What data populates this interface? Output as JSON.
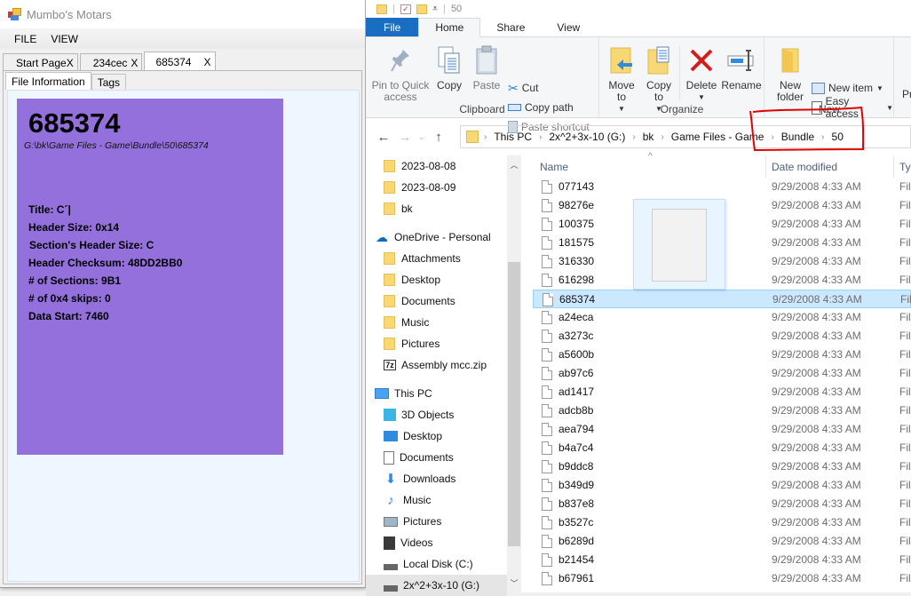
{
  "app": {
    "title": "Mumbo's Motars",
    "menu": [
      "FILE",
      "VIEW"
    ],
    "doc_tabs": [
      {
        "label": "Start Page",
        "close": "X",
        "active": false
      },
      {
        "label": "234cec",
        "close": "X",
        "active": false
      },
      {
        "label": "685374",
        "close": "X",
        "active": true
      }
    ],
    "sub_tabs": [
      {
        "label": "File Information",
        "active": true
      },
      {
        "label": "Tags",
        "active": false
      }
    ],
    "file_info": {
      "id": "685374",
      "path": "G:\\bk\\Game Files - Game\\Bundle\\50\\685374",
      "fields": [
        "Title: C´|",
        "Header Size: 0x14",
        "Section's Header Size: C",
        "Header Checksum: 48DD2BB0",
        "# of Sections: 9B1",
        "# of 0x4 skips: 0",
        "Data Start: 7460"
      ],
      "card_color": "#9370db"
    }
  },
  "explorer": {
    "quick_access_title": "50",
    "ribbon_tabs": [
      "File",
      "Home",
      "Share",
      "View"
    ],
    "active_ribbon_tab": "Home",
    "clipboard": {
      "label": "Clipboard",
      "pin": "Pin to Quick access",
      "copy": "Copy",
      "paste": "Paste",
      "cut": "Cut",
      "copy_path": "Copy path",
      "paste_shortcut": "Paste shortcut"
    },
    "organize": {
      "label": "Organize",
      "move_to": "Move to",
      "copy_to": "Copy to",
      "delete": "Delete",
      "rename": "Rename"
    },
    "new": {
      "label": "New",
      "new_folder": "New folder",
      "new_item": "New item",
      "easy_access": "Easy access"
    },
    "open_partial": "Pr",
    "breadcrumb": [
      "This PC",
      "2x^2+3x-10 (G:)",
      "bk",
      "Game Files - Game",
      "Bundle",
      "50"
    ],
    "nav_pane": [
      {
        "label": "2023-08-08",
        "icon": "folder"
      },
      {
        "label": "2023-08-09",
        "icon": "folder"
      },
      {
        "label": "bk",
        "icon": "folder"
      },
      {
        "label": "OneDrive - Personal",
        "icon": "onedrive"
      },
      {
        "label": "Attachments",
        "icon": "folder"
      },
      {
        "label": "Desktop",
        "icon": "folder"
      },
      {
        "label": "Documents",
        "icon": "folder"
      },
      {
        "label": "Music",
        "icon": "folder"
      },
      {
        "label": "Pictures",
        "icon": "folder"
      },
      {
        "label": "Assembly mcc.zip",
        "icon": "zip"
      },
      {
        "label": "This PC",
        "icon": "pc"
      },
      {
        "label": "3D Objects",
        "icon": "3d"
      },
      {
        "label": "Desktop",
        "icon": "desktop"
      },
      {
        "label": "Documents",
        "icon": "documents"
      },
      {
        "label": "Downloads",
        "icon": "downloads"
      },
      {
        "label": "Music",
        "icon": "music"
      },
      {
        "label": "Pictures",
        "icon": "pictures"
      },
      {
        "label": "Videos",
        "icon": "videos"
      },
      {
        "label": "Local Disk (C:)",
        "icon": "disk"
      },
      {
        "label": "2x^2+3x-10 (G:)",
        "icon": "disk",
        "selected": true
      }
    ],
    "columns": {
      "name": "Name",
      "date": "Date modified",
      "type": "Typ"
    },
    "files": [
      {
        "name": "077143",
        "date": "9/29/2008 4:33 AM",
        "type": "Fil"
      },
      {
        "name": "98276e",
        "date": "9/29/2008 4:33 AM",
        "type": "Fil"
      },
      {
        "name": "100375",
        "date": "9/29/2008 4:33 AM",
        "type": "Fil"
      },
      {
        "name": "181575",
        "date": "9/29/2008 4:33 AM",
        "type": "Fil"
      },
      {
        "name": "316330",
        "date": "9/29/2008 4:33 AM",
        "type": "Fil"
      },
      {
        "name": "616298",
        "date": "9/29/2008 4:33 AM",
        "type": "Fil"
      },
      {
        "name": "685374",
        "date": "9/29/2008 4:33 AM",
        "type": "Fil",
        "selected": true
      },
      {
        "name": "a24eca",
        "date": "9/29/2008 4:33 AM",
        "type": "Fil"
      },
      {
        "name": "a3273c",
        "date": "9/29/2008 4:33 AM",
        "type": "Fil"
      },
      {
        "name": "a5600b",
        "date": "9/29/2008 4:33 AM",
        "type": "Fil"
      },
      {
        "name": "ab97c6",
        "date": "9/29/2008 4:33 AM",
        "type": "Fil"
      },
      {
        "name": "ad1417",
        "date": "9/29/2008 4:33 AM",
        "type": "Fil"
      },
      {
        "name": "adcb8b",
        "date": "9/29/2008 4:33 AM",
        "type": "Fil"
      },
      {
        "name": "aea794",
        "date": "9/29/2008 4:33 AM",
        "type": "Fil"
      },
      {
        "name": "b4a7c4",
        "date": "9/29/2008 4:33 AM",
        "type": "Fil"
      },
      {
        "name": "b9ddc8",
        "date": "9/29/2008 4:33 AM",
        "type": "Fil"
      },
      {
        "name": "b349d9",
        "date": "9/29/2008 4:33 AM",
        "type": "Fil"
      },
      {
        "name": "b837e8",
        "date": "9/29/2008 4:33 AM",
        "type": "Fil"
      },
      {
        "name": "b3527c",
        "date": "9/29/2008 4:33 AM",
        "type": "Fil"
      },
      {
        "name": "b6289d",
        "date": "9/29/2008 4:33 AM",
        "type": "Fil"
      },
      {
        "name": "b21454",
        "date": "9/29/2008 4:33 AM",
        "type": "Fil"
      },
      {
        "name": "b67961",
        "date": "9/29/2008 4:33 AM",
        "type": "Fil"
      }
    ]
  },
  "colors": {
    "file_tab": "#1a6ec2",
    "selection": "#cce8ff",
    "annotation": "#e00000"
  }
}
